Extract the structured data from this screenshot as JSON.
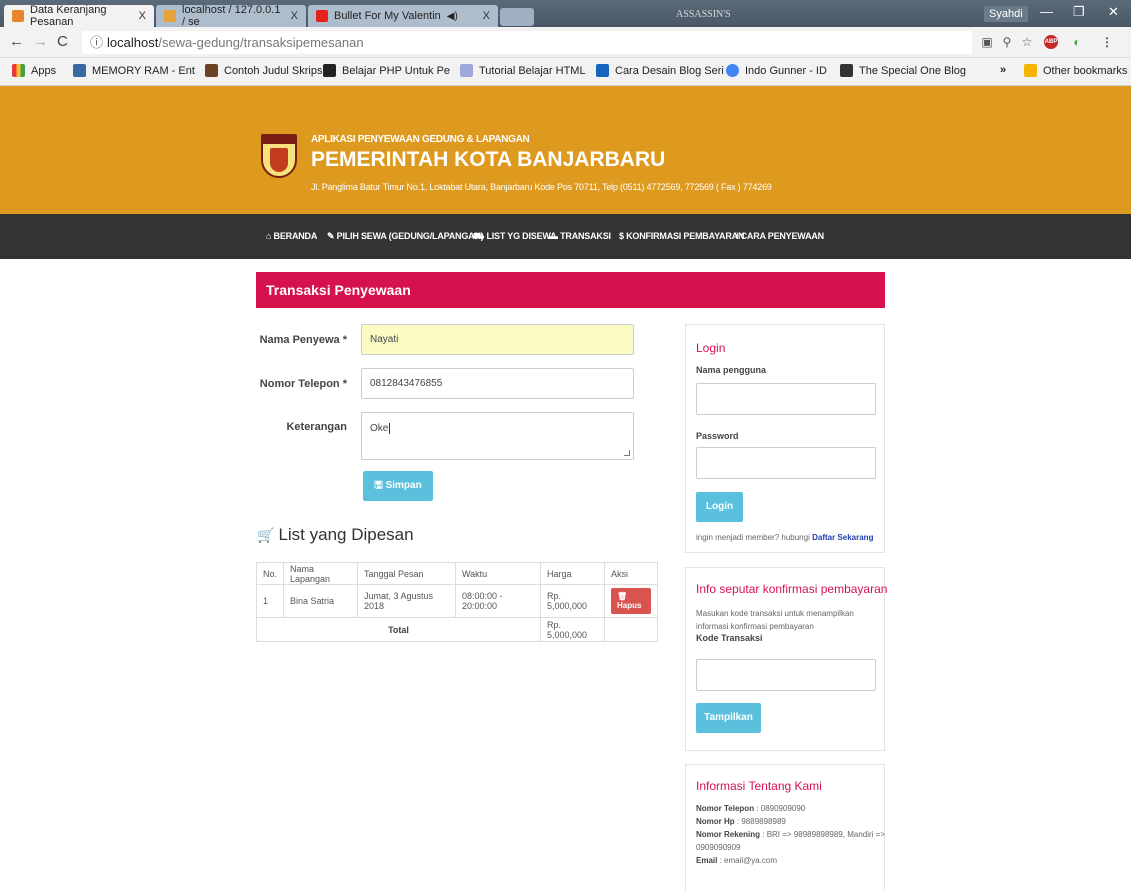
{
  "browser": {
    "tabs": [
      {
        "title": "Data Keranjang Pesanan",
        "close": "X"
      },
      {
        "title": "localhost / 127.0.0.1 / se",
        "close": "X"
      },
      {
        "title": "Bullet For My Valentin",
        "close": "X",
        "audio": "◀)"
      }
    ],
    "title_overlay": "ASSASSIN'S",
    "user": "Syahdi",
    "url_host": "localhost",
    "url_path": "/sewa-gedung/transaksipemesanan",
    "bookmarks": [
      "Apps",
      "MEMORY RAM - Ent",
      "Contoh Judul Skripsi",
      "Belajar PHP Untuk Pe",
      "Tutorial Belajar HTML",
      "Cara Desain Blog Seri",
      "Indo Gunner - ID",
      "The Special One Blog"
    ],
    "more": "»",
    "other_bookmarks": "Other bookmarks"
  },
  "site": {
    "subtitle": "APLIKASI PENYEWAAN GEDUNG & LAPANGAN",
    "title": "PEMERINTAH KOTA BANJARBARU",
    "address": "Jl. Panglima Batur Timur No.1, Loktabat Utara, Banjarbaru Kode Pos 70711, Telp (0511) 4772569, 772569 ( Fax ) 774269",
    "logo_text": "BANJARBARU"
  },
  "nav": [
    "BERANDA",
    "PILIH SEWA (GEDUNG/LAPANGAN)",
    "LIST YG DISEWA",
    "TRANSAKSI",
    "$ KONFIRMASI PEMBAYARAN",
    "i CARA PENYEWAAN"
  ],
  "form": {
    "header": "Transaksi Penyewaan",
    "nama_label": "Nama Penyewa *",
    "nama_value": "Nayati",
    "telp_label": "Nomor Telepon *",
    "telp_value": "0812843476855",
    "ket_label": "Keterangan",
    "ket_value": "Oke",
    "submit": "Simpan"
  },
  "list": {
    "title": "List yang Dipesan",
    "headers": [
      "No.",
      "Nama Lapangan",
      "Tanggal Pesan",
      "Waktu",
      "Harga",
      "Aksi"
    ],
    "rows": [
      {
        "no": "1",
        "nama": "Bina Satria",
        "tanggal": "Jumat, 3 Agustus 2018",
        "waktu": "08:00:00 - 20:00:00",
        "harga": "Rp. 5,000,000",
        "aksi": "Hapus"
      }
    ],
    "total_label": "Total",
    "total_value": "Rp. 5,000,000"
  },
  "login": {
    "title": "Login",
    "user_label": "Nama pengguna",
    "pass_label": "Password",
    "button": "Login",
    "member_text": "ingin menjadi member? hubungi",
    "member_link": "Daftar Sekarang"
  },
  "konfirmasi": {
    "title": "Info seputar konfirmasi pembayaran",
    "desc1": "Masukan kode transaksi untuk menampilkan",
    "desc2": "informasi konfirmasi pembayaran",
    "kode_label": "Kode Transaksi",
    "button": "Tampilkan"
  },
  "info": {
    "title": "Informasi Tentang Kami",
    "telp_label": "Nomor Telepon",
    "telp": ": 0890909090",
    "hp_label": "Nomor Hp",
    "hp": ": 9889898989",
    "rek_label": "Nomor Rekening",
    "rek": ": BRI => 98989898989, Mandiri =>",
    "rek2": "0909090909",
    "email_label": "Email",
    "email": ": email@ya.com"
  }
}
